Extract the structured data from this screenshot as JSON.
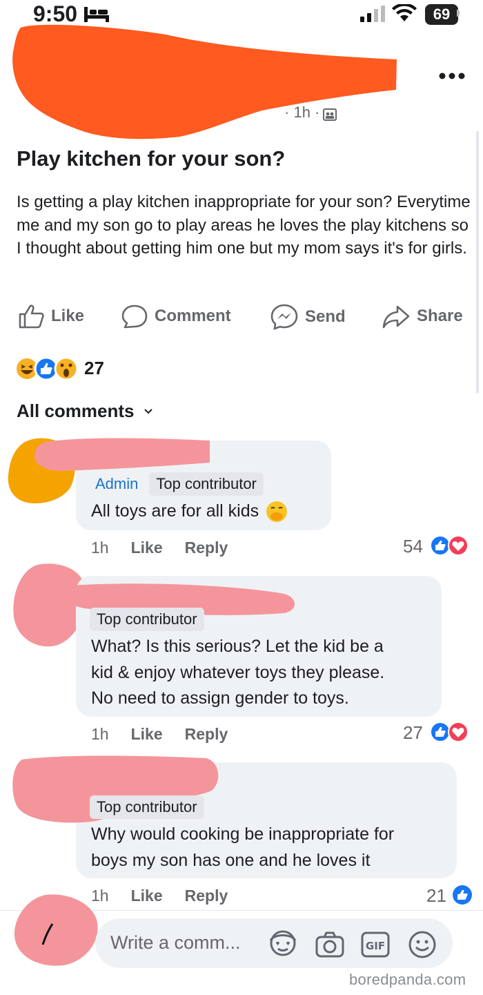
{
  "status_bar": {
    "time": "9:50",
    "battery": "69"
  },
  "post": {
    "time": "1h",
    "title": "Play kitchen for your son?",
    "body": "Is getting a play kitchen inappropriate for your son? Everytime me and my son go to play areas he loves the play kitchens so I thought about getting him one but my mom says it's for girls.",
    "actions": {
      "like": "Like",
      "comment": "Comment",
      "send": "Send",
      "share": "Share"
    },
    "reaction_count": "27",
    "reactions": [
      "haha-icon",
      "like-icon",
      "wow-icon"
    ]
  },
  "comments_header": "All comments",
  "comments": [
    {
      "badges": [
        "Admin",
        "Top contributor"
      ],
      "text": "All toys are for all kids",
      "emoji": "🤭",
      "time": "1h",
      "like": "Like",
      "reply": "Reply",
      "count": "54",
      "reactions": [
        "like-icon",
        "love-icon"
      ]
    },
    {
      "badges": [
        "Top contributor"
      ],
      "lines": [
        "What? Is this serious? Let the kid be a",
        "kid & enjoy whatever toys they please.",
        "No need to assign gender to toys."
      ],
      "time": "1h",
      "like": "Like",
      "reply": "Reply",
      "count": "27",
      "reactions": [
        "like-icon",
        "love-icon"
      ]
    },
    {
      "badges": [
        "Top contributor"
      ],
      "lines": [
        "Why would cooking be inappropriate for",
        "boys my son has one and he loves it"
      ],
      "time": "1h",
      "like": "Like",
      "reply": "Reply",
      "count": "21",
      "reactions": [
        "like-icon"
      ]
    }
  ],
  "composer": {
    "placeholder": "Write a comm...",
    "icons": [
      "avatar-sticker-icon",
      "camera-icon",
      "gif-icon",
      "emoji-icon"
    ]
  },
  "watermark": "boredpanda.com",
  "colors": {
    "redaction_orange": "#ff5a1f",
    "redaction_pink": "#f4959c",
    "avatar_orange": "#f5a300",
    "fb_blue": "#1877f2",
    "love_red": "#f33e58"
  }
}
